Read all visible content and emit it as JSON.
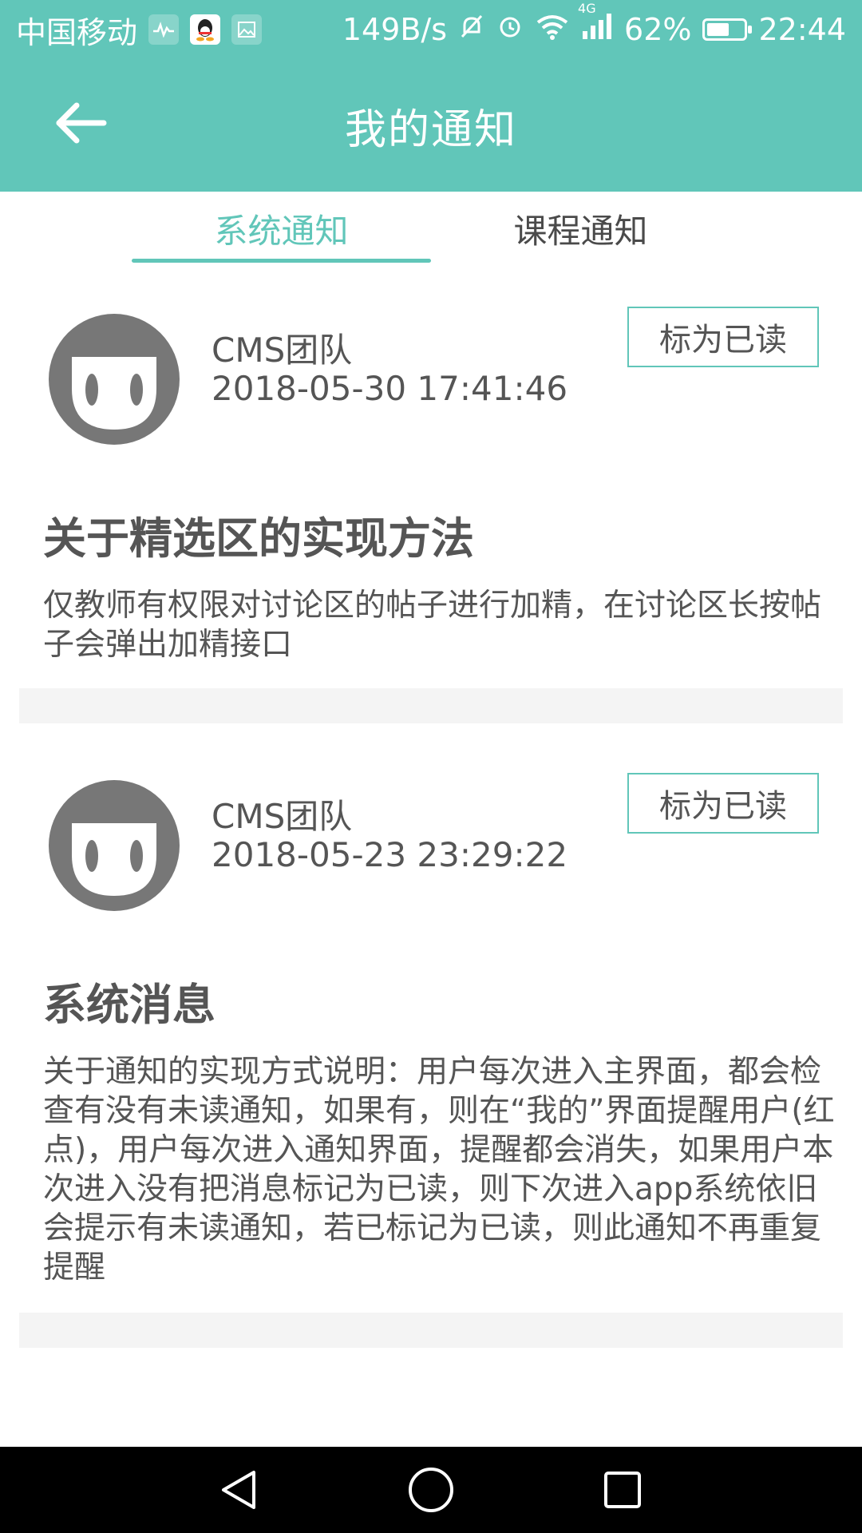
{
  "status_bar": {
    "carrier": "中国移动",
    "net_speed": "149B/s",
    "signal_type": "4G",
    "battery_text": "62%",
    "battery_level": 0.62,
    "time": "22:44",
    "icons": [
      "health-app-icon",
      "qq-icon",
      "gallery-icon",
      "mute-icon",
      "alarm-icon",
      "wifi-icon",
      "cellular-signal-icon",
      "battery-icon"
    ]
  },
  "app_bar": {
    "title": "我的通知",
    "back_icon": "arrow-left-icon"
  },
  "tabs": [
    {
      "label": "系统通知",
      "active": true
    },
    {
      "label": "课程通知",
      "active": false
    }
  ],
  "notices": [
    {
      "sender": "CMS团队",
      "time": "2018-05-30 17:41:46",
      "action_label": "标为已读",
      "title": "关于精选区的实现方法",
      "body": "仅教师有权限对讨论区的帖子进行加精，在讨论区长按帖子会弹出加精接口"
    },
    {
      "sender": "CMS团队",
      "time": "2018-05-23 23:29:22",
      "action_label": "标为已读",
      "title": "系统消息",
      "body": "关于通知的实现方式说明：用户每次进入主界面，都会检查有没有未读通知，如果有，则在“我的”界面提醒用户(红点)，用户每次进入通知界面，提醒都会消失，如果用户本次进入没有把消息标记为已读，则下次进入app系统依旧会提示有未读通知，若已标记为已读，则此通知不再重复提醒"
    }
  ],
  "colors": {
    "accent": "#61c6b9",
    "text": "#555555",
    "separator": "#f4f4f4"
  },
  "nav_bar": {
    "buttons": [
      "back-triangle-icon",
      "home-circle-icon",
      "recents-square-icon"
    ]
  }
}
